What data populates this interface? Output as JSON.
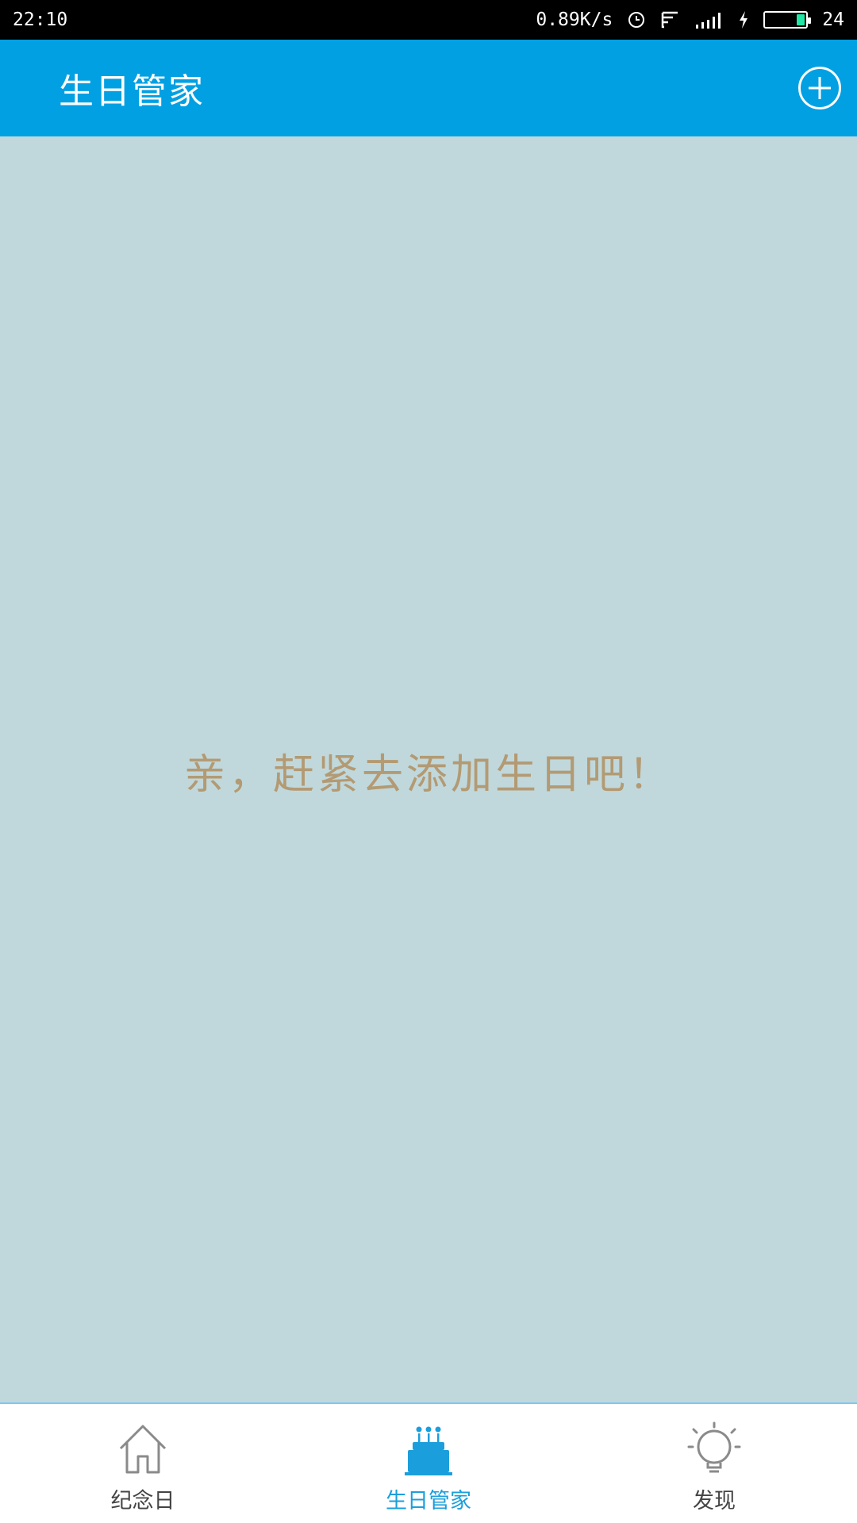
{
  "status_bar": {
    "time": "22:10",
    "network_speed": "0.89K/s",
    "battery_level": "24",
    "icons": [
      "alarm-icon",
      "wifi-icon",
      "signal-icon",
      "charging-icon",
      "battery-icon"
    ]
  },
  "app_bar": {
    "title": "生日管家",
    "action_icon": "add-circle-icon"
  },
  "main": {
    "empty_message": "亲，赶紧去添加生日吧！"
  },
  "bottom_nav": {
    "active_index": 1,
    "items": [
      {
        "label": "纪念日",
        "icon": "home-icon"
      },
      {
        "label": "生日管家",
        "icon": "cake-icon"
      },
      {
        "label": "发现",
        "icon": "lightbulb-icon"
      }
    ]
  },
  "colors": {
    "primary": "#00a0e3",
    "background": "#c0d8dc",
    "empty_text": "#b39a73",
    "nav_active": "#1b9fdc",
    "nav_inactive": "#8a8a8a"
  }
}
